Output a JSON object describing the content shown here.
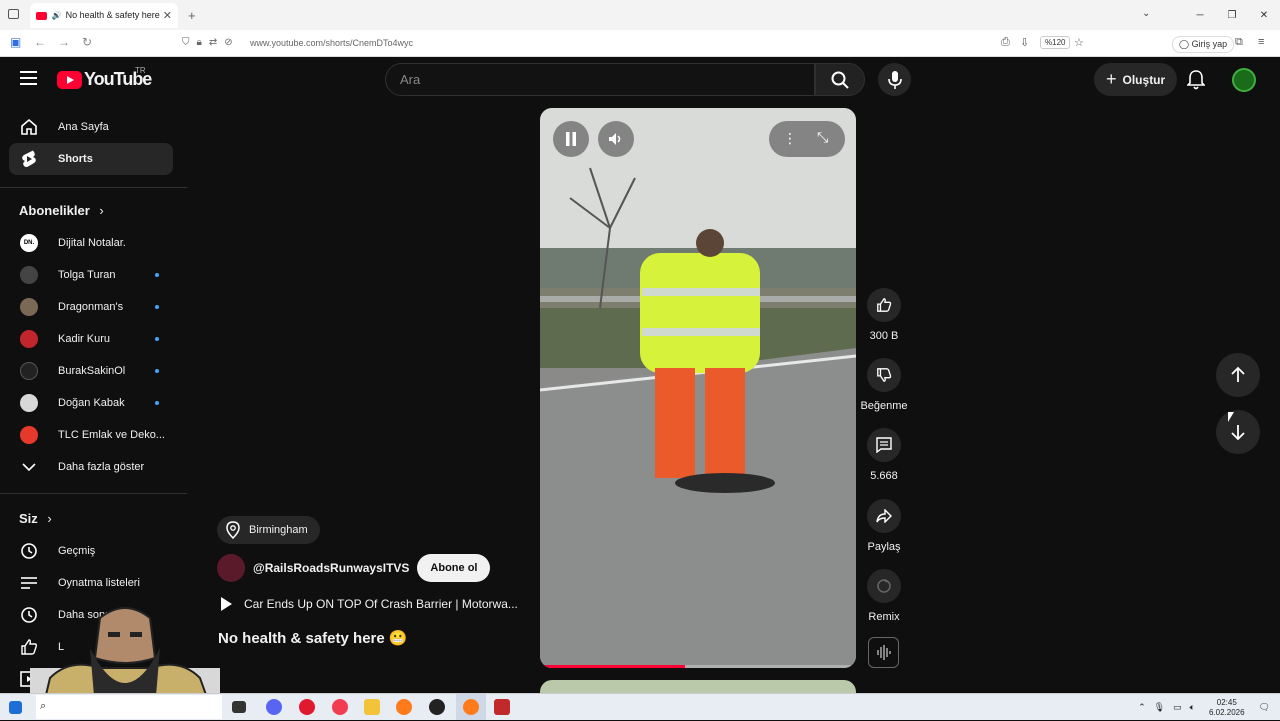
{
  "browser": {
    "tab_title": "No health & safety here 😬",
    "url": "www.youtube.com/shorts/CnemDTo4wyc",
    "zoom": "%120",
    "signin_label": "Giriş yap"
  },
  "header": {
    "logo_text": "YouTube",
    "country_code": "TR",
    "search_placeholder": "Ara",
    "create_label": "Oluştur"
  },
  "sidebar": {
    "main": [
      {
        "label": "Ana Sayfa",
        "icon": "home-icon"
      },
      {
        "label": "Shorts",
        "icon": "shorts-icon"
      }
    ],
    "subscriptions_title": "Abonelikler",
    "subscriptions": [
      {
        "label": "Dijital Notalar.",
        "color": "#ffffff",
        "new": false
      },
      {
        "label": "Tolga Turan",
        "color": "#444444",
        "new": true
      },
      {
        "label": "Dragonman's",
        "color": "#7a6a55",
        "new": true
      },
      {
        "label": "Kadir Kuru",
        "color": "#c0262b",
        "new": true
      },
      {
        "label": "BurakSakinOl",
        "color": "#222222",
        "new": true
      },
      {
        "label": "Doğan Kabak",
        "color": "#d8d8d8",
        "new": true
      },
      {
        "label": "TLC Emlak ve Deko...",
        "color": "#e6392c",
        "new": false
      }
    ],
    "show_more": "Daha fazla göster",
    "you_title": "Siz",
    "you": [
      {
        "label": "Geçmiş",
        "icon": "history-icon"
      },
      {
        "label": "Oynatma listeleri",
        "icon": "playlists-icon"
      },
      {
        "label": "Daha sonra i",
        "icon": "watch-later-icon"
      },
      {
        "label": "L",
        "icon": "like-icon"
      },
      {
        "label": "",
        "icon": "your-videos-icon"
      }
    ]
  },
  "short": {
    "location": "Birmingham",
    "channel": "@RailsRoadsRunwaysITVS",
    "subscribe_label": "Abone ol",
    "suggestion": "Car Ends Up ON TOP Of Crash Barrier | Motorwa...",
    "title": "No health & safety here 😬",
    "progress": 0.46
  },
  "actions": {
    "likes": "300 B",
    "dislike": "Beğenme",
    "comments": "5.668",
    "share": "Paylaş",
    "remix": "Remix"
  },
  "taskbar": {
    "time": "02:45",
    "date": "6.02.2026"
  }
}
